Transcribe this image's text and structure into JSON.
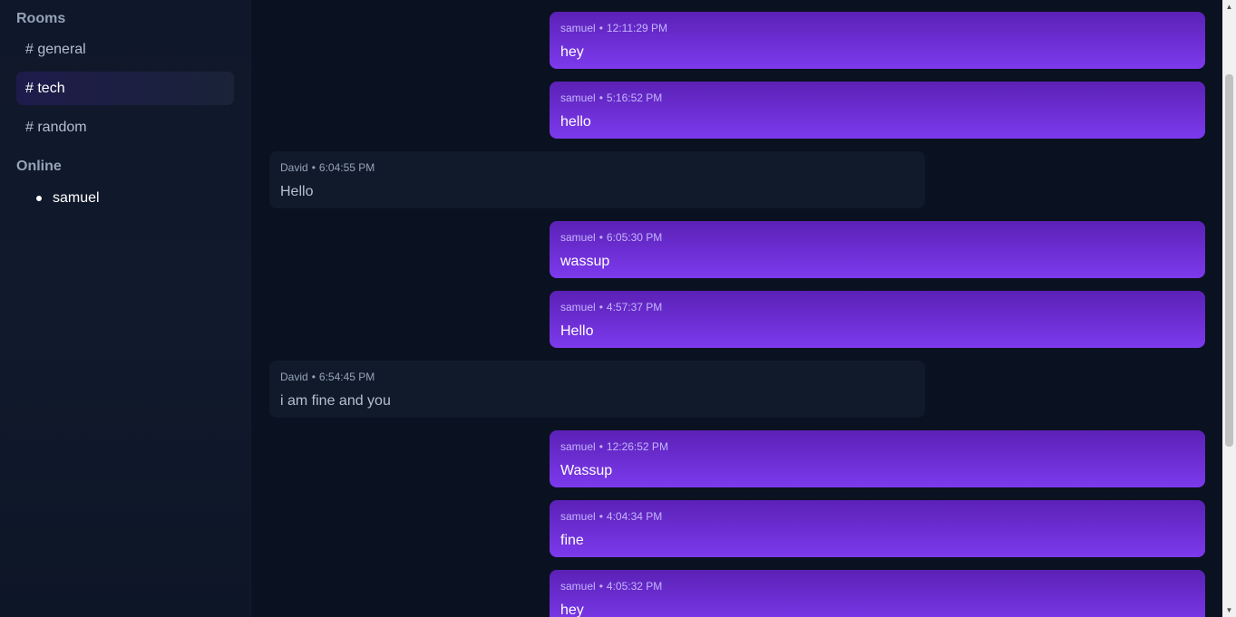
{
  "sidebar": {
    "rooms_title": "Rooms",
    "rooms": [
      {
        "label": "# general",
        "active": false
      },
      {
        "label": "# tech",
        "active": true
      },
      {
        "label": "# random",
        "active": false
      }
    ],
    "online_title": "Online",
    "online_users": [
      {
        "name": "samuel"
      }
    ]
  },
  "messages": [
    {
      "author": "samuel",
      "time": "12:11:29 PM",
      "text": "hey",
      "own": true
    },
    {
      "author": "samuel",
      "time": "5:16:52 PM",
      "text": "hello",
      "own": true
    },
    {
      "author": "David",
      "time": "6:04:55 PM",
      "text": "Hello",
      "own": false
    },
    {
      "author": "samuel",
      "time": "6:05:30 PM",
      "text": "wassup",
      "own": true
    },
    {
      "author": "samuel",
      "time": "4:57:37 PM",
      "text": "Hello",
      "own": true
    },
    {
      "author": "David",
      "time": "6:54:45 PM",
      "text": "i am fine and you",
      "own": false
    },
    {
      "author": "samuel",
      "time": "12:26:52 PM",
      "text": "Wassup",
      "own": true
    },
    {
      "author": "samuel",
      "time": "4:04:34 PM",
      "text": "fine",
      "own": true
    },
    {
      "author": "samuel",
      "time": "4:05:32 PM",
      "text": "hey",
      "own": true
    }
  ],
  "meta_separator": "•",
  "colors": {
    "own_bubble_top": "#5b21b6",
    "own_bubble_bottom": "#7c3aed",
    "other_bubble": "#111a2b",
    "background": "#0a1120"
  }
}
